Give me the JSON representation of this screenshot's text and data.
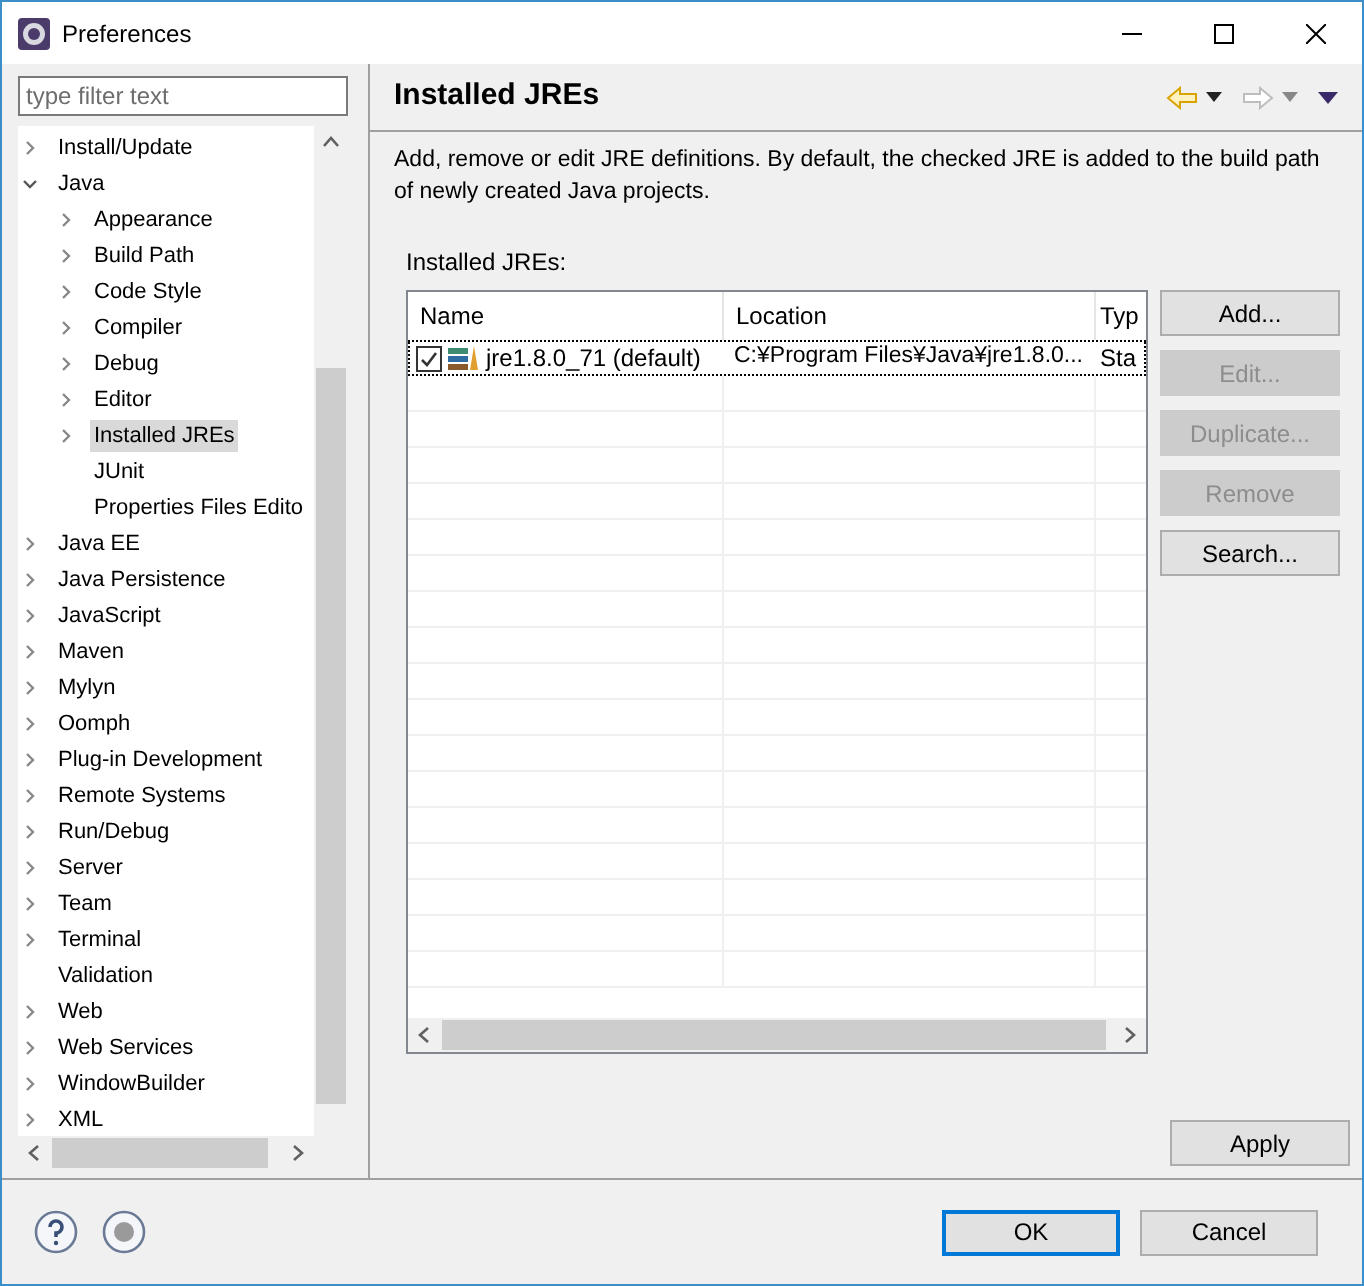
{
  "window": {
    "title": "Preferences"
  },
  "filter": {
    "placeholder": "type filter text"
  },
  "tree": [
    {
      "label": "Install/Update",
      "kind": "node",
      "expanded": false,
      "selected": false
    },
    {
      "label": "Java",
      "kind": "node",
      "expanded": true,
      "selected": false,
      "children": [
        {
          "label": "Appearance",
          "kind": "node",
          "expanded": false,
          "selected": false
        },
        {
          "label": "Build Path",
          "kind": "node",
          "expanded": false,
          "selected": false
        },
        {
          "label": "Code Style",
          "kind": "node",
          "expanded": false,
          "selected": false
        },
        {
          "label": "Compiler",
          "kind": "node",
          "expanded": false,
          "selected": false
        },
        {
          "label": "Debug",
          "kind": "node",
          "expanded": false,
          "selected": false
        },
        {
          "label": "Editor",
          "kind": "node",
          "expanded": false,
          "selected": false
        },
        {
          "label": "Installed JREs",
          "kind": "node",
          "expanded": false,
          "selected": true
        },
        {
          "label": "JUnit",
          "kind": "leaf",
          "selected": false
        },
        {
          "label": "Properties Files Edito",
          "kind": "leaf",
          "selected": false
        }
      ]
    },
    {
      "label": "Java EE",
      "kind": "node",
      "expanded": false,
      "selected": false
    },
    {
      "label": "Java Persistence",
      "kind": "node",
      "expanded": false,
      "selected": false
    },
    {
      "label": "JavaScript",
      "kind": "node",
      "expanded": false,
      "selected": false
    },
    {
      "label": "Maven",
      "kind": "node",
      "expanded": false,
      "selected": false
    },
    {
      "label": "Mylyn",
      "kind": "node",
      "expanded": false,
      "selected": false
    },
    {
      "label": "Oomph",
      "kind": "node",
      "expanded": false,
      "selected": false
    },
    {
      "label": "Plug-in Development",
      "kind": "node",
      "expanded": false,
      "selected": false
    },
    {
      "label": "Remote Systems",
      "kind": "node",
      "expanded": false,
      "selected": false
    },
    {
      "label": "Run/Debug",
      "kind": "node",
      "expanded": false,
      "selected": false
    },
    {
      "label": "Server",
      "kind": "node",
      "expanded": false,
      "selected": false
    },
    {
      "label": "Team",
      "kind": "node",
      "expanded": false,
      "selected": false
    },
    {
      "label": "Terminal",
      "kind": "node",
      "expanded": false,
      "selected": false
    },
    {
      "label": "Validation",
      "kind": "leaf",
      "selected": false
    },
    {
      "label": "Web",
      "kind": "node",
      "expanded": false,
      "selected": false
    },
    {
      "label": "Web Services",
      "kind": "node",
      "expanded": false,
      "selected": false
    },
    {
      "label": "WindowBuilder",
      "kind": "node",
      "expanded": false,
      "selected": false
    },
    {
      "label": "XML",
      "kind": "node",
      "expanded": false,
      "selected": false
    }
  ],
  "page": {
    "title": "Installed JREs",
    "description": "Add, remove or edit JRE definitions. By default, the checked JRE is added to the build path of newly created Java projects.",
    "list_label": "Installed JREs:"
  },
  "table": {
    "columns": [
      "Name",
      "Location",
      "Typ"
    ],
    "rows": [
      {
        "name": "jre1.8.0_71 (default)",
        "location": "C:¥Program Files¥Java¥jre1.8.0...",
        "type": "Sta",
        "checked": true
      }
    ]
  },
  "side_buttons": [
    {
      "label": "Add...",
      "disabled": false
    },
    {
      "label": "Edit...",
      "disabled": true
    },
    {
      "label": "Duplicate...",
      "disabled": true
    },
    {
      "label": "Remove",
      "disabled": true
    },
    {
      "label": "Search...",
      "disabled": false
    }
  ],
  "apply_button": {
    "label": "Apply"
  },
  "dialog_buttons": [
    {
      "label": "OK",
      "default": true
    },
    {
      "label": "Cancel",
      "default": false
    }
  ]
}
